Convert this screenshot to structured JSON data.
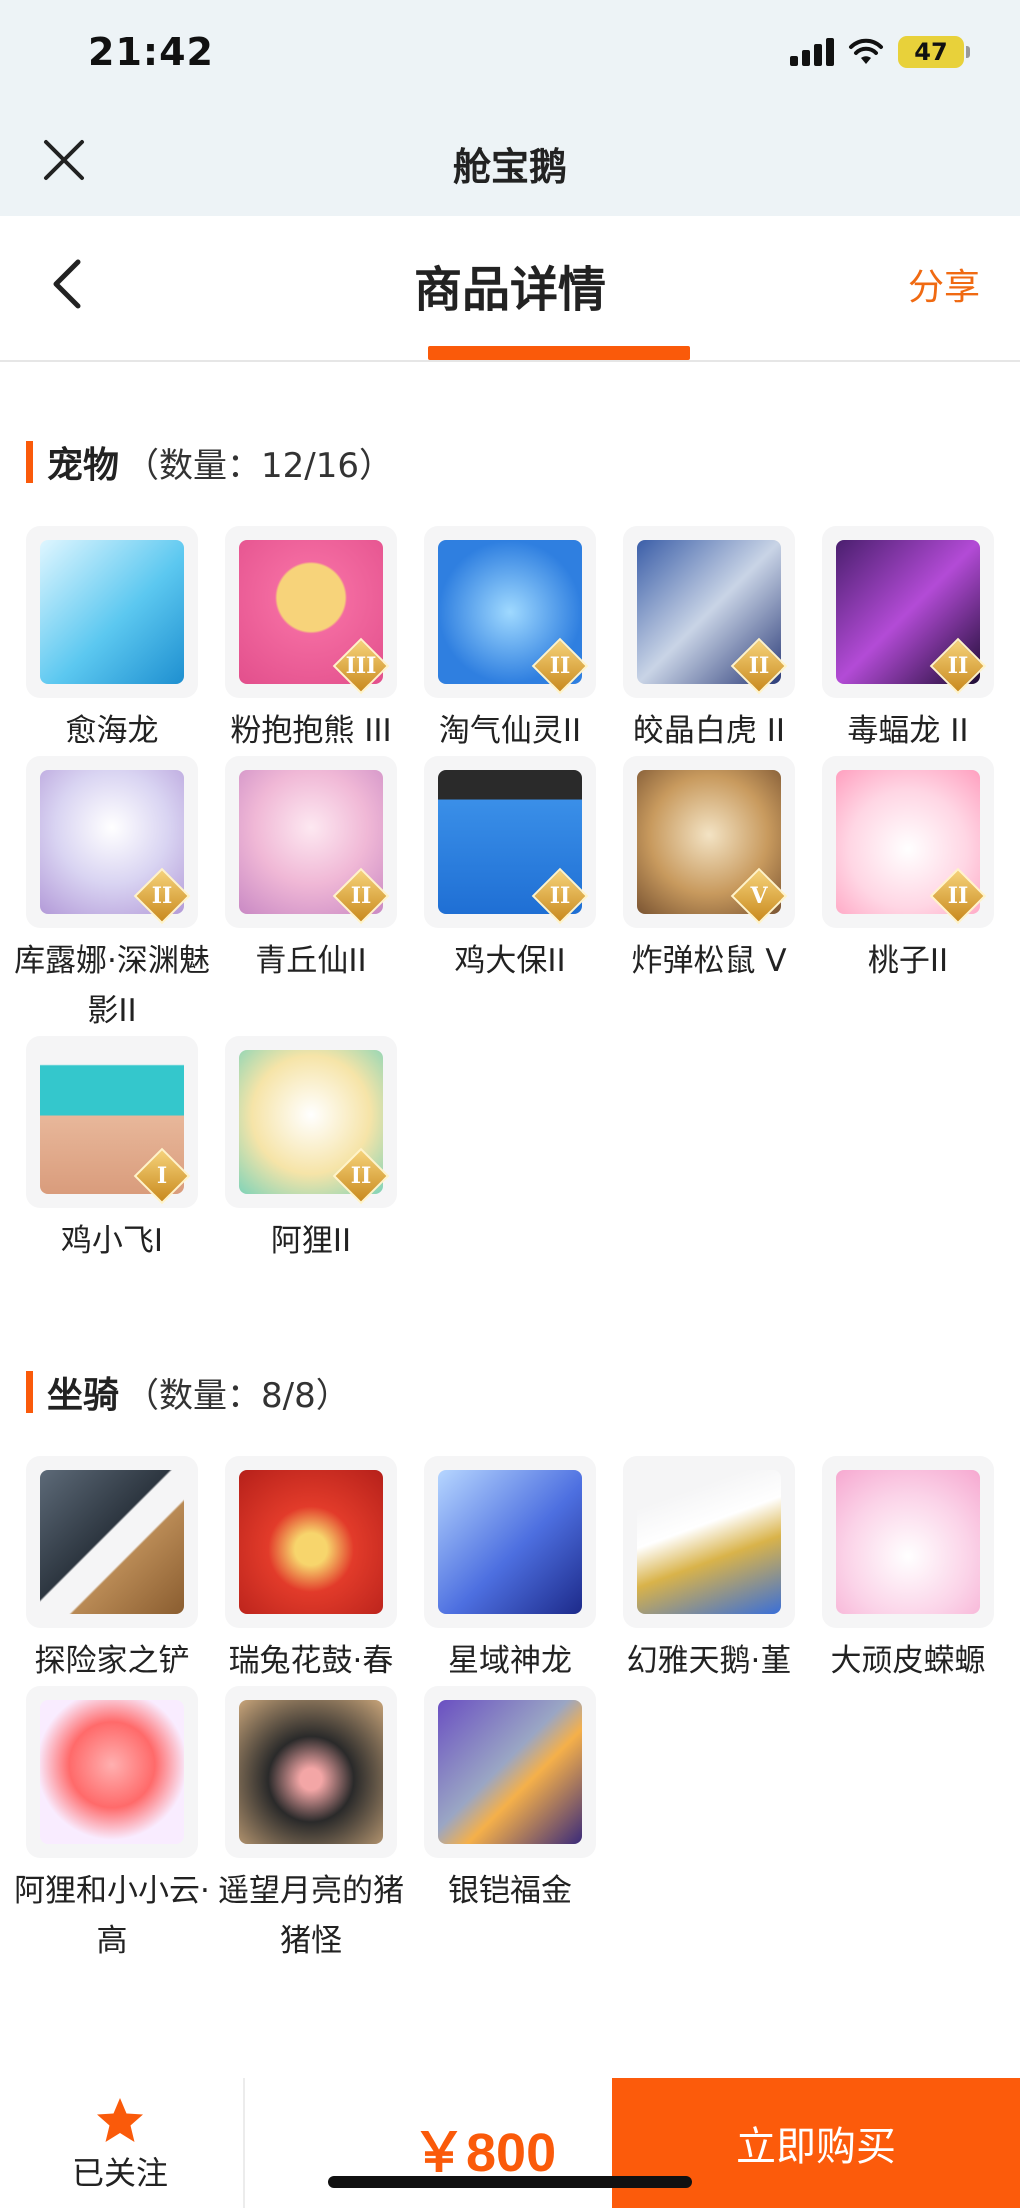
{
  "status_bar": {
    "time": "21:42",
    "battery": "47"
  },
  "app_bar": {
    "title": "舱宝鹅",
    "close_icon": "close-icon"
  },
  "header": {
    "title": "商品详情",
    "share_label": "分享",
    "back_icon": "chevron-left-icon"
  },
  "colors": {
    "accent": "#fa5a0a",
    "share": "#f06a12",
    "battery": "#e8d13a"
  },
  "pets": {
    "title": "宠物",
    "count": "（数量：12/16）",
    "items": [
      {
        "name": "愈海龙",
        "badge": "",
        "art": "dragon-art"
      },
      {
        "name": "粉抱抱熊 III",
        "badge": "III",
        "art": "bear-art"
      },
      {
        "name": "淘气仙灵II",
        "badge": "II",
        "art": "sprite-art"
      },
      {
        "name": "皎晶白虎 II",
        "badge": "II",
        "art": "tiger-art"
      },
      {
        "name": "毒蝠龙 II",
        "badge": "II",
        "art": "bat-dragon-art"
      },
      {
        "name": "库露娜·深渊魅影II",
        "badge": "II",
        "art": "kuluna-art"
      },
      {
        "name": "青丘仙II",
        "badge": "II",
        "art": "fox-fairy-art"
      },
      {
        "name": "鸡大保II",
        "badge": "II",
        "art": "chicken-art"
      },
      {
        "name": "炸弹松鼠 V",
        "badge": "V",
        "art": "squirrel-art"
      },
      {
        "name": "桃子II",
        "badge": "II",
        "art": "peach-cat-art"
      },
      {
        "name": "鸡小飞I",
        "badge": "I",
        "art": "chick-art"
      },
      {
        "name": "阿狸II",
        "badge": "II",
        "art": "ali-art"
      }
    ]
  },
  "mounts": {
    "title": "坐骑",
    "count": "（数量：8/8）",
    "items": [
      {
        "name": "探险家之铲",
        "art": "shovel-art"
      },
      {
        "name": "瑞兔花鼓·春",
        "art": "drum-art"
      },
      {
        "name": "星域神龙",
        "art": "star-dragon-art"
      },
      {
        "name": "幻雅天鹅·堇",
        "art": "swan-art"
      },
      {
        "name": "大顽皮蝾螈",
        "art": "salamander-art"
      },
      {
        "name": "阿狸和小小云·高",
        "art": "ali-cloud-art"
      },
      {
        "name": "遥望月亮的猪猪怪",
        "art": "pig-art"
      },
      {
        "name": "银铠福金",
        "art": "silver-armor-art"
      }
    ]
  },
  "bottom_bar": {
    "follow_label": "已关注",
    "follow_icon": "star-icon",
    "price": "￥800",
    "buy_label": "立即购买"
  }
}
